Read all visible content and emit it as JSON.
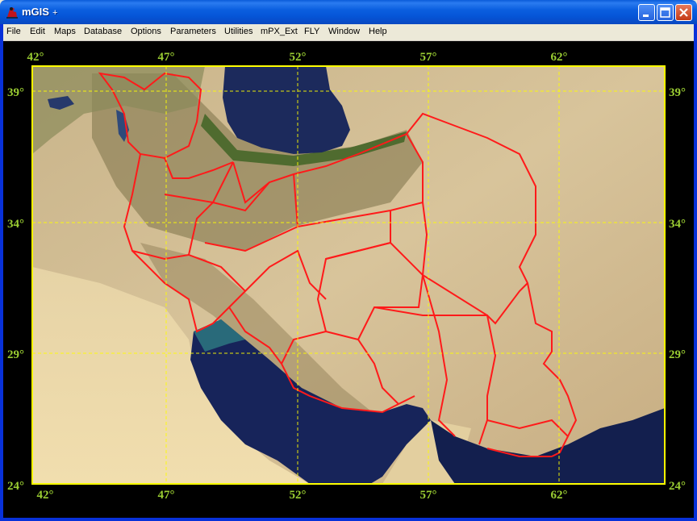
{
  "window": {
    "title": "mGIS",
    "title_suffix": "+"
  },
  "menu": [
    "File",
    "Edit",
    "Maps",
    "Database",
    "Options",
    "Parameters",
    "Utilities",
    "mPX_Ext",
    "FLY",
    "Window",
    "Help"
  ],
  "map": {
    "longitude_labels": [
      "42°",
      "47°",
      "52°",
      "57°",
      "62°"
    ],
    "latitude_labels": [
      "39°",
      "34°",
      "29°",
      "24°"
    ],
    "grid_color": "#ffff00",
    "label_color": "#9acd32",
    "border_color": "#ff0000",
    "content": "satellite-map-iran-provinces"
  },
  "colors": {
    "titlebar": "#0554d6",
    "menubar": "#ece9d8",
    "map_background": "#000000"
  }
}
